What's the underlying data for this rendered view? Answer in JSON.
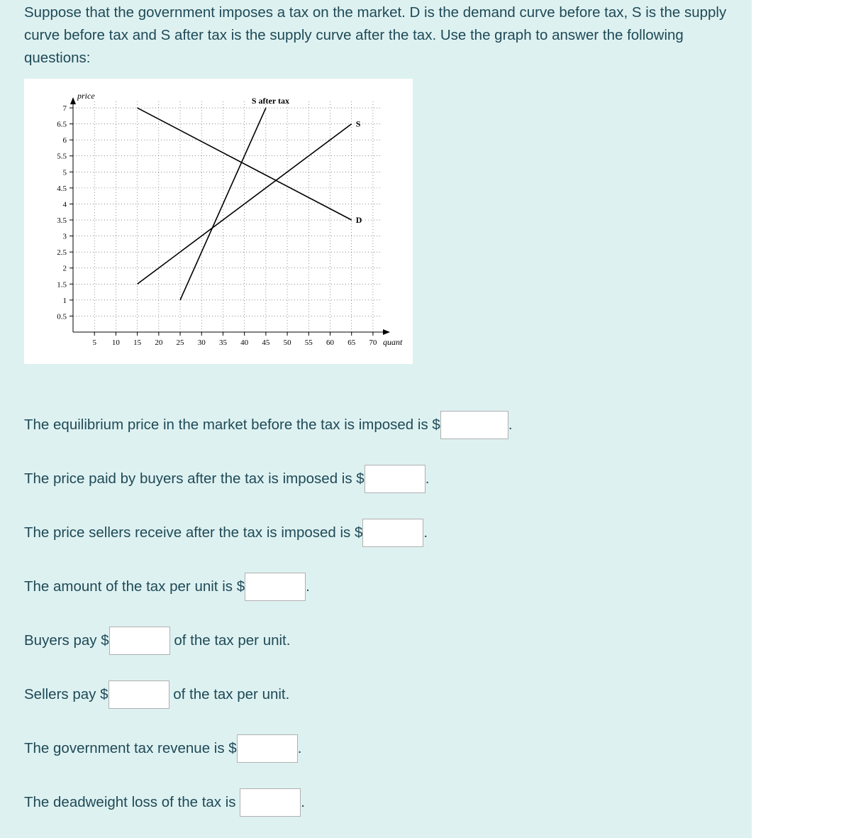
{
  "intro": "Suppose that the government imposes a tax on the market. D is the demand curve before tax, S is the supply curve before tax and S after tax is the supply curve after the tax. Use the graph to answer the following questions:",
  "q1": {
    "pre": "The equilibrium price in the market before the tax is imposed is $",
    "post": "."
  },
  "q2": {
    "pre": "The price paid by buyers after the tax is imposed is $",
    "post": "."
  },
  "q3": {
    "pre": "The price sellers receive after the tax is imposed is $",
    "post": "."
  },
  "q4": {
    "pre": "The amount of the tax per unit is $",
    "post": "."
  },
  "q5": {
    "pre": "Buyers pay $",
    "post": " of the tax per unit."
  },
  "q6": {
    "pre": "Sellers pay $",
    "post": " of the tax per unit."
  },
  "q7": {
    "pre": "The government tax revenue is $",
    "post": "."
  },
  "q8": {
    "pre": "The deadweight loss of the tax is ",
    "post": "."
  },
  "chart_data": {
    "type": "line",
    "title": "",
    "xlabel": "quantity",
    "ylabel": "price",
    "xlim": [
      0,
      72
    ],
    "ylim": [
      0,
      7.2
    ],
    "xticks": [
      5,
      10,
      15,
      20,
      25,
      30,
      35,
      40,
      45,
      50,
      55,
      60,
      65,
      70
    ],
    "yticks": [
      0.5,
      1,
      1.5,
      2,
      2.5,
      3,
      3.5,
      4,
      4.5,
      5,
      5.5,
      6,
      6.5,
      7
    ],
    "series": [
      {
        "name": "D",
        "points": [
          [
            15,
            7
          ],
          [
            65,
            3.5
          ]
        ]
      },
      {
        "name": "S",
        "points": [
          [
            15,
            1.5
          ],
          [
            65,
            6.5
          ]
        ]
      },
      {
        "name": "S after tax",
        "points": [
          [
            25,
            1
          ],
          [
            45,
            7
          ]
        ]
      }
    ],
    "grid": true,
    "labels": {
      "y_axis_title": "price",
      "x_axis_title": "quantity",
      "D": "D",
      "S": "S",
      "S_after_tax": "S after tax"
    }
  }
}
